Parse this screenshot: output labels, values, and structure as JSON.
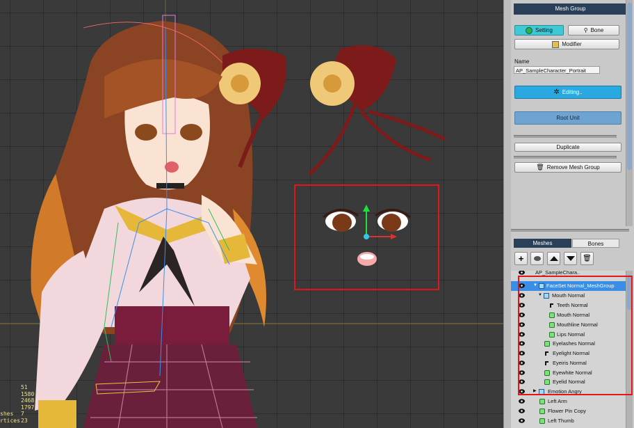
{
  "viewport": {
    "stats": [
      {
        "key": "",
        "value": "51"
      },
      {
        "key": "",
        "value": "1580"
      },
      {
        "key": "",
        "value": "2468"
      },
      {
        "key": "",
        "value": "1797"
      },
      {
        "key": "shes",
        "value": "7"
      },
      {
        "key": "rtices",
        "value": "23"
      }
    ]
  },
  "panel": {
    "title": "Mesh Group",
    "setting_label": "Setting",
    "bone_label": "Bone",
    "modifier_label": "Modifier",
    "name_label": "Name",
    "name_value": "AP_SampleCharacter_Portrait",
    "editing_label": "Editing..",
    "root_unit_label": "Root Unit",
    "duplicate_label": "Duplicate",
    "remove_label": "Remove Mesh Group",
    "tabs": {
      "meshes": "Meshes",
      "bones": "Bones"
    },
    "tree": [
      {
        "label": "AP_SampleChara..",
        "icon": "group",
        "depth": 0
      },
      {
        "label": "FaceSet Normal_MeshGroup",
        "icon": "group",
        "depth": 1,
        "selected": true
      },
      {
        "label": "Mouth Normal",
        "icon": "group",
        "depth": 2
      },
      {
        "label": "Teeth Normal",
        "icon": "clip",
        "depth": 3
      },
      {
        "label": "Mouth Normal",
        "icon": "mesh",
        "depth": 3
      },
      {
        "label": "Mouthline Normal",
        "icon": "mesh",
        "depth": 3
      },
      {
        "label": "Lips Normal",
        "icon": "mesh",
        "depth": 3
      },
      {
        "label": "Eyelashes Normal",
        "icon": "mesh",
        "depth": 2
      },
      {
        "label": "Eyelight Normal",
        "icon": "clip",
        "depth": 2
      },
      {
        "label": "Eyeiris Normal",
        "icon": "clip",
        "depth": 2
      },
      {
        "label": "Eyewhite Normal",
        "icon": "mesh",
        "depth": 2
      },
      {
        "label": "Eyelid Normal",
        "icon": "mesh",
        "depth": 2
      },
      {
        "label": "Emotion Angry",
        "icon": "group",
        "depth": 1
      },
      {
        "label": "Left Arm",
        "icon": "mesh",
        "depth": 1
      },
      {
        "label": "Flower Pin Copy",
        "icon": "mesh",
        "depth": 1
      },
      {
        "label": "Left Thumb",
        "icon": "mesh",
        "depth": 1
      }
    ]
  },
  "colors": {
    "highlight_box": "#e4141a",
    "selected_row": "#3b8ee6",
    "header": "#2a3f58",
    "editing": "#2aa9e0"
  }
}
